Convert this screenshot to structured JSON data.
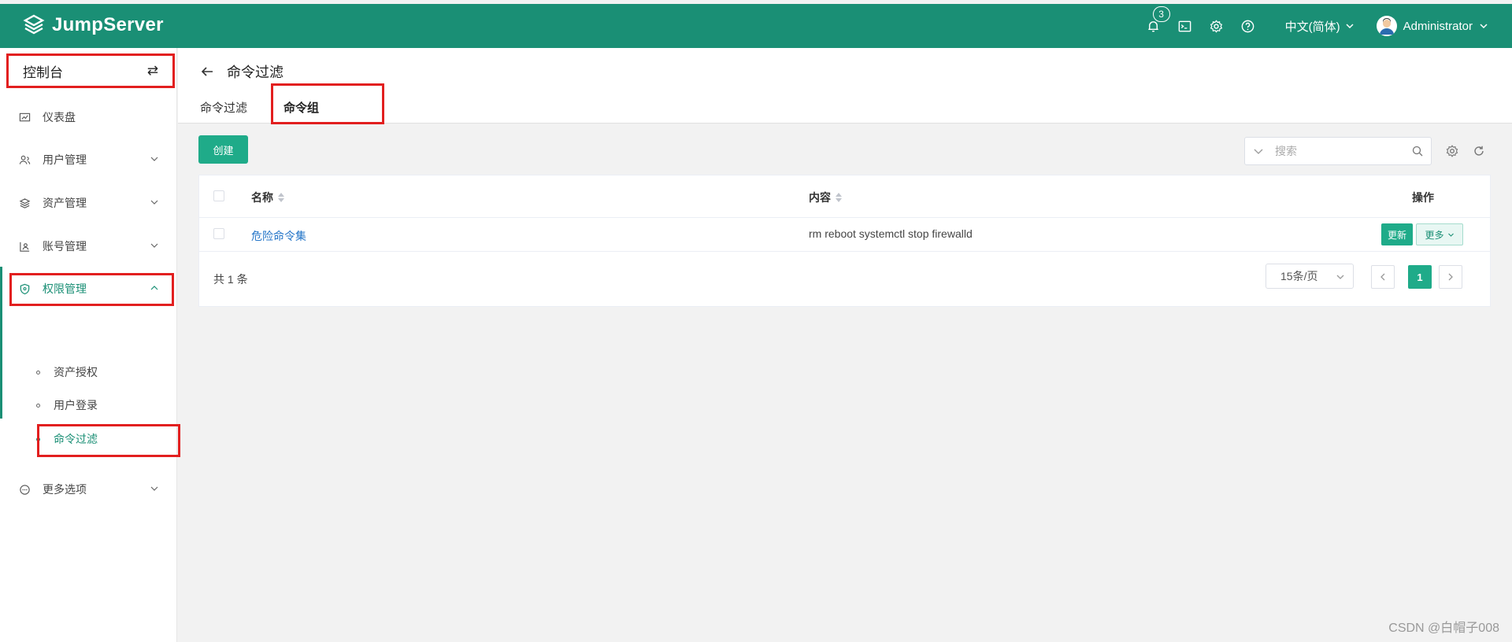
{
  "brand": {
    "name": "JumpServer"
  },
  "topbar": {
    "notification_count": "3",
    "language": "中文(简体)",
    "user_name": "Administrator",
    "icons": [
      "bell-icon",
      "terminal-icon",
      "gear-icon",
      "help-icon"
    ]
  },
  "sidebar": {
    "console_label": "控制台",
    "switch_symbol": "⇄",
    "items": [
      {
        "label": "仪表盘",
        "icon": "dashboard-icon"
      },
      {
        "label": "用户管理",
        "icon": "users-icon"
      },
      {
        "label": "资产管理",
        "icon": "layers-icon"
      },
      {
        "label": "账号管理",
        "icon": "account-icon"
      },
      {
        "label": "权限管理",
        "icon": "shield-icon"
      },
      {
        "label": "更多选项",
        "icon": "more-icon"
      }
    ],
    "sub_items": [
      {
        "label": "资产授权"
      },
      {
        "label": "用户登录"
      },
      {
        "label": "命令过滤"
      }
    ]
  },
  "header": {
    "title": "命令过滤",
    "tabs": [
      {
        "label": "命令过滤"
      },
      {
        "label": "命令组"
      }
    ]
  },
  "toolbar": {
    "create_label": "创建",
    "search_placeholder": "搜索"
  },
  "table": {
    "columns": [
      "名称",
      "内容",
      "操作"
    ],
    "rows": [
      {
        "name": "危险命令集",
        "content": "rm reboot systemctl stop firewalld",
        "update_label": "更新",
        "more_label": "更多"
      }
    ]
  },
  "pagination": {
    "total_text": "共 1 条",
    "page_size": "15条/页",
    "current_page": "1"
  },
  "watermark": "CSDN @白帽子008",
  "colors": {
    "brand": "#1a8f75",
    "primary_button": "#1fab89",
    "highlight_box": "#e21f1f",
    "link": "#2475c8"
  }
}
